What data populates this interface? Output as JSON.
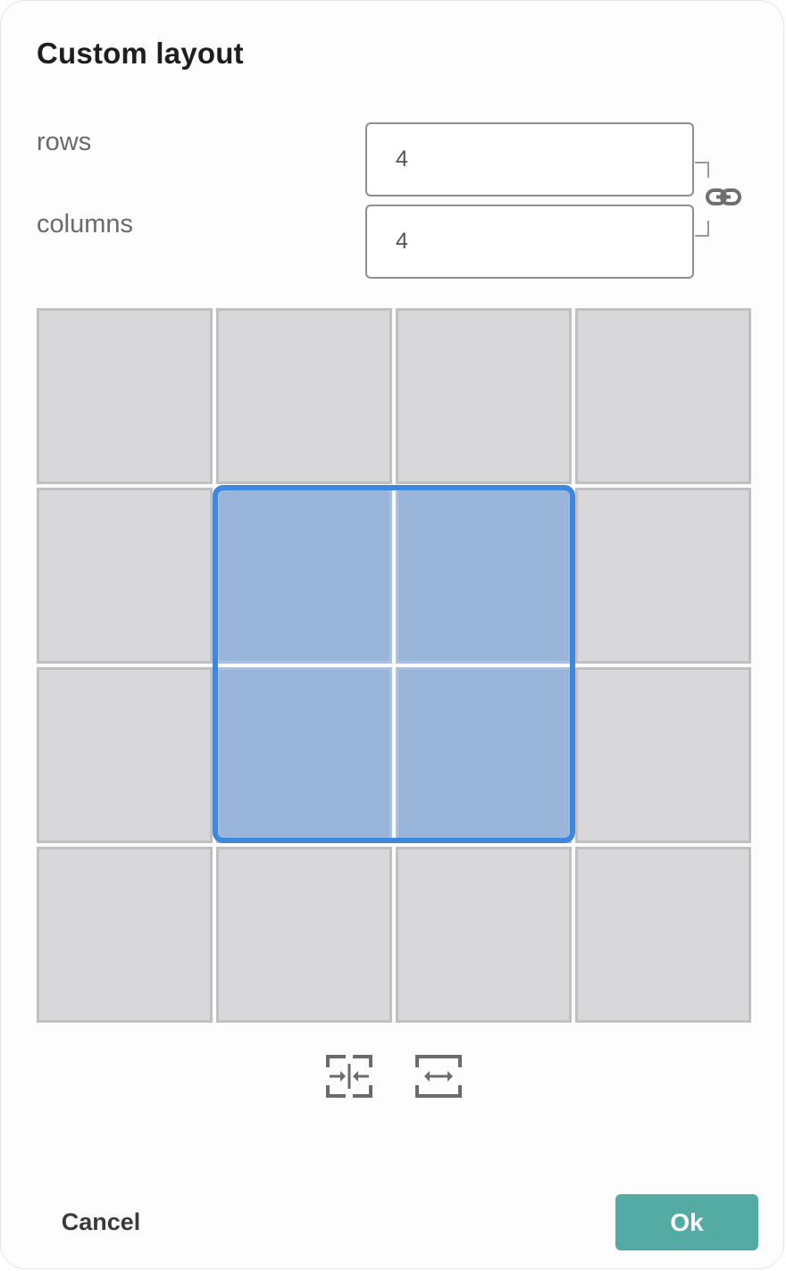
{
  "dialog": {
    "title": "Custom layout",
    "rows_label": "rows",
    "rows_value": "4",
    "columns_label": "columns",
    "columns_value": "4",
    "link_icon": "link-icon",
    "grid": {
      "rows": 4,
      "columns": 4,
      "selected_cells": [
        [
          1,
          1
        ],
        [
          1,
          2
        ],
        [
          2,
          1
        ],
        [
          2,
          2
        ]
      ],
      "cell_color": "#d8d7da",
      "selected_color": "#9ab5da",
      "selection_outline_color": "#3d87dc"
    },
    "tools": [
      {
        "icon": "merge-cells-icon"
      },
      {
        "icon": "split-cells-icon"
      }
    ],
    "cancel_label": "Cancel",
    "ok_label": "Ok",
    "ok_color": "#54aba4"
  }
}
